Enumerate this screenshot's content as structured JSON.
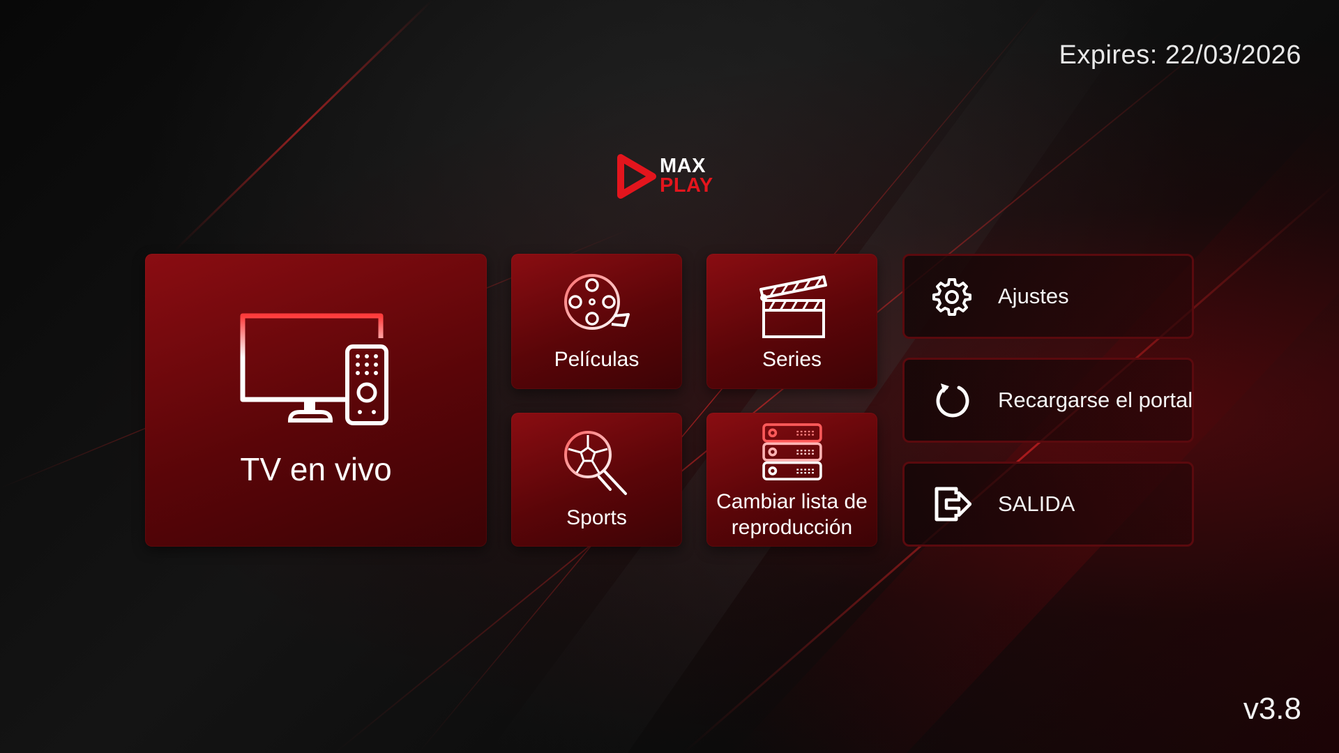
{
  "header": {
    "expires_text": "Expires: 22/03/2026"
  },
  "logo": {
    "line1": "MAX",
    "line2": "PLAY"
  },
  "tiles": {
    "live_tv": {
      "label": "TV en vivo",
      "icon": "tv-remote-icon"
    },
    "movies": {
      "label": "Películas",
      "icon": "film-reel-icon"
    },
    "series": {
      "label": "Series",
      "icon": "clapperboard-icon"
    },
    "sports": {
      "label": "Sports",
      "icon": "soccer-ball-icon"
    },
    "playlist": {
      "label": "Cambiar lista de reproducción",
      "icon": "server-list-icon"
    }
  },
  "side_menu": {
    "settings": {
      "label": "Ajustes",
      "icon": "gear-icon"
    },
    "reload": {
      "label": "Recargarse el portal",
      "icon": "refresh-icon"
    },
    "exit": {
      "label": "SALIDA",
      "icon": "exit-icon"
    }
  },
  "footer": {
    "version": "v3.8"
  },
  "colors": {
    "accent": "#e3151d",
    "tile": "#7a0a0f",
    "background": "#0a0a0a"
  }
}
